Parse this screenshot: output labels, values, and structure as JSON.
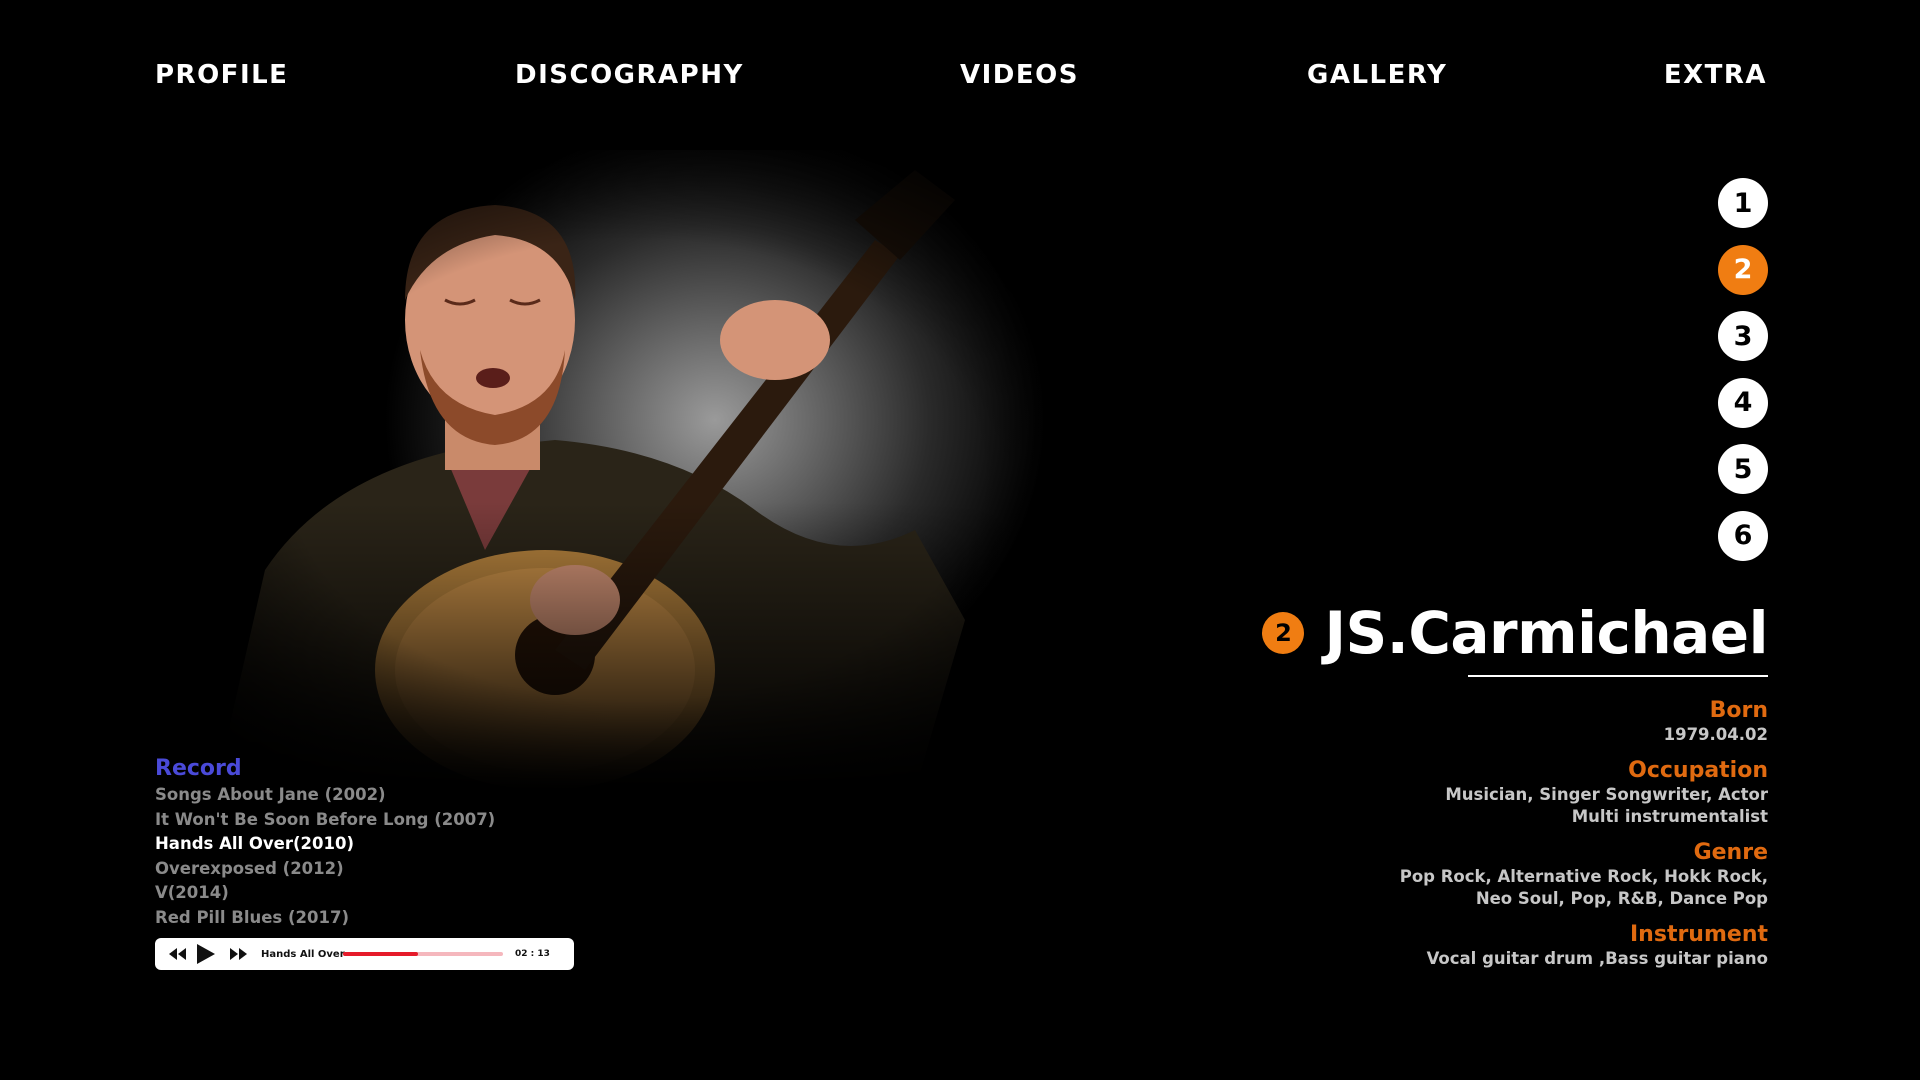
{
  "nav": {
    "items": [
      {
        "label": "PROFILE"
      },
      {
        "label": "DISCOGRAPHY"
      },
      {
        "label": "VIDEOS"
      },
      {
        "label": "GALLERY"
      },
      {
        "label": "EXTRA"
      }
    ]
  },
  "pager": {
    "pages": [
      "1",
      "2",
      "3",
      "4",
      "5",
      "6"
    ],
    "active": "2"
  },
  "artist": {
    "badge": "2",
    "name": "JS.Carmichael"
  },
  "info": {
    "born_label": "Born",
    "born_value": "1979.04.02",
    "occupation_label": "Occupation",
    "occupation_line1": "Musician, Singer Songwriter, Actor",
    "occupation_line2": "Multi instrumentalist",
    "genre_label": "Genre",
    "genre_line1": "Pop Rock, Alternative Rock, Hokk Rock,",
    "genre_line2": "Neo Soul, Pop, R&B, Dance Pop",
    "instrument_label": "Instrument",
    "instrument_value": "Vocal guitar drum ,Bass guitar piano"
  },
  "record": {
    "title": "Record",
    "items": [
      "Songs About Jane (2002)",
      "It Won't Be Soon Before Long (2007)",
      "Hands All Over(2010)",
      "Overexposed (2012)",
      "V(2014)",
      "Red Pill Blues (2017)"
    ],
    "active_index": 2
  },
  "player": {
    "track": "Hands All Over",
    "time": "02 : 13",
    "progress": 0.47
  },
  "colors": {
    "accent": "#f07d12",
    "label": "#e06a10",
    "record_title": "#4a4ad8",
    "progress": "#e51a2a"
  },
  "icons": [
    "rewind-icon",
    "play-icon",
    "fast-forward-icon"
  ]
}
